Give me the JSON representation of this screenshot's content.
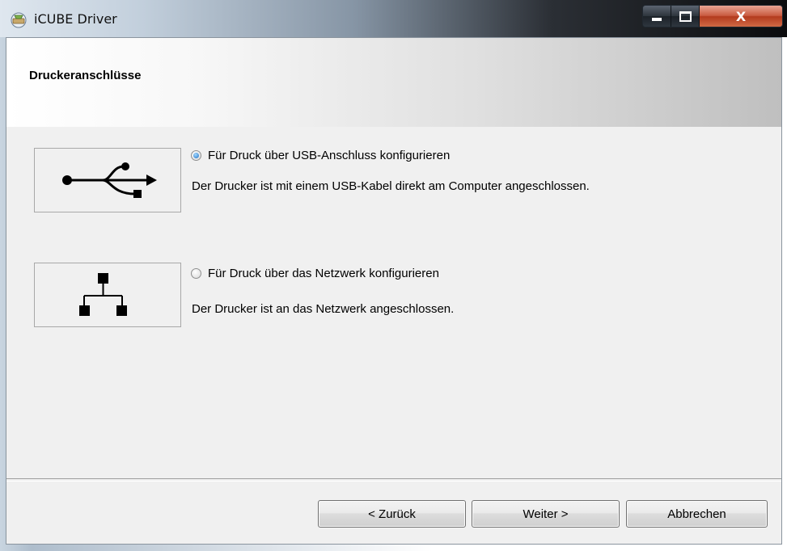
{
  "window": {
    "title": "iCUBE Driver",
    "close_glyph": "X"
  },
  "header": {
    "title": "Druckeranschlüsse"
  },
  "options": [
    {
      "id": "usb",
      "icon": "usb-icon",
      "label": "Für Druck über USB-Anschluss konfigurieren",
      "description": "Der Drucker ist mit einem USB-Kabel direkt am Computer angeschlossen.",
      "selected": true
    },
    {
      "id": "network",
      "icon": "network-icon",
      "label": "Für Druck über das Netzwerk konfigurieren",
      "description": "Der Drucker ist an das Netzwerk angeschlossen.",
      "selected": false
    }
  ],
  "footer": {
    "back_label": "< Zurück",
    "next_label": "Weiter >",
    "cancel_label": "Abbrechen"
  },
  "colors": {
    "radio_selected": "#1a6fc4",
    "close_button": "#c95a40"
  }
}
